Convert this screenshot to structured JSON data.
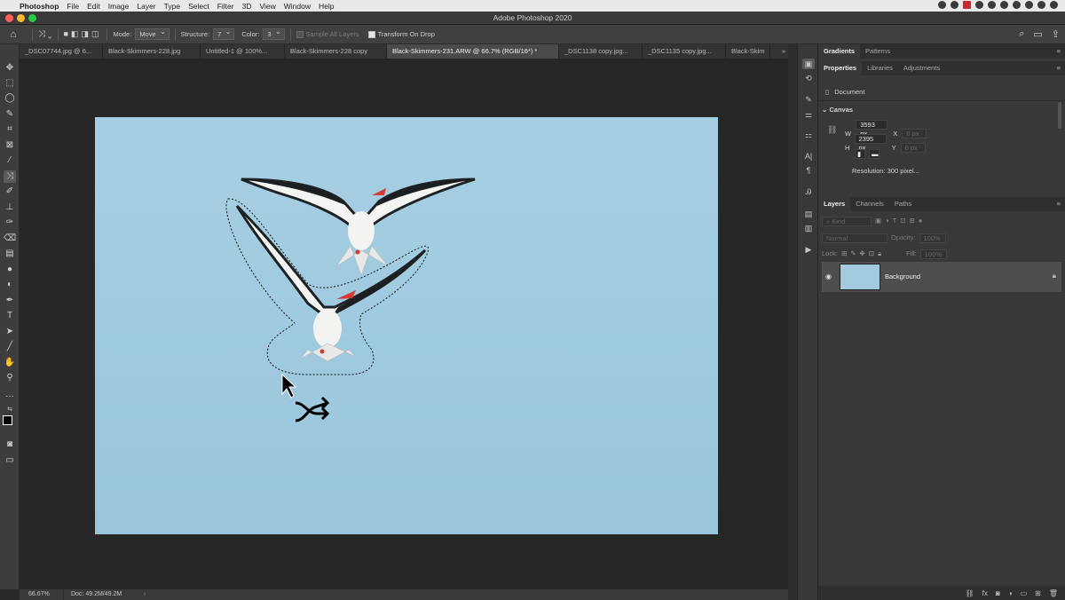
{
  "menubar": {
    "app_name": "Photoshop",
    "menus": [
      "File",
      "Edit",
      "Image",
      "Layer",
      "Type",
      "Select",
      "Filter",
      "3D",
      "View",
      "Window",
      "Help"
    ]
  },
  "window": {
    "title": "Adobe Photoshop 2020"
  },
  "options_bar": {
    "mode_label": "Mode:",
    "mode_value": "Move",
    "structure_label": "Structure:",
    "structure_value": "7",
    "color_label": "Color:",
    "color_value": "3",
    "sample_all_layers": "Sample All Layers",
    "transform_on_drop": "Transform On Drop"
  },
  "doc_tabs": [
    "_DSC07744.jpg @ 6...",
    "Black-Skimmers-228.jpg",
    "Untitled-1 @ 100%...",
    "Black-Skimmers-228 copy",
    "Black-Skimmers-231.ARW @ 66.7% (RGB/16*) *",
    "_DSC1138 copy.jpg...",
    "_DSC1135 copy.jpg...",
    "Black-Skim"
  ],
  "status_bar": {
    "zoom": "66.67%",
    "doc_size": "Doc: 49.2M/49.2M"
  },
  "properties": {
    "top_tabs": [
      "Gradients",
      "Patterns"
    ],
    "tabs": [
      "Properties",
      "Libraries",
      "Adjustments"
    ],
    "document_label": "Document",
    "canvas_label": "Canvas",
    "w_label": "W",
    "w_value": "3593 px",
    "x_label": "X",
    "x_value": "0 px",
    "h_label": "H",
    "h_value": "2395 px",
    "y_label": "Y",
    "y_value": "0 px",
    "resolution": "Resolution: 300 pixel..."
  },
  "layers_panel": {
    "tabs": [
      "Layers",
      "Channels",
      "Paths"
    ],
    "kind_placeholder": "Kind",
    "blend_mode": "Normal",
    "opacity_label": "Opacity:",
    "opacity_value": "100%",
    "lock_label": "Lock:",
    "fill_label": "Fill:",
    "fill_value": "100%",
    "layers": [
      {
        "name": "Background"
      }
    ]
  },
  "colors": {
    "canvas_sky": "#a2cbe0",
    "ui_dark": "#383838",
    "traffic_red": "#fe5f57",
    "traffic_yellow": "#febc2e",
    "traffic_green": "#28c840"
  }
}
